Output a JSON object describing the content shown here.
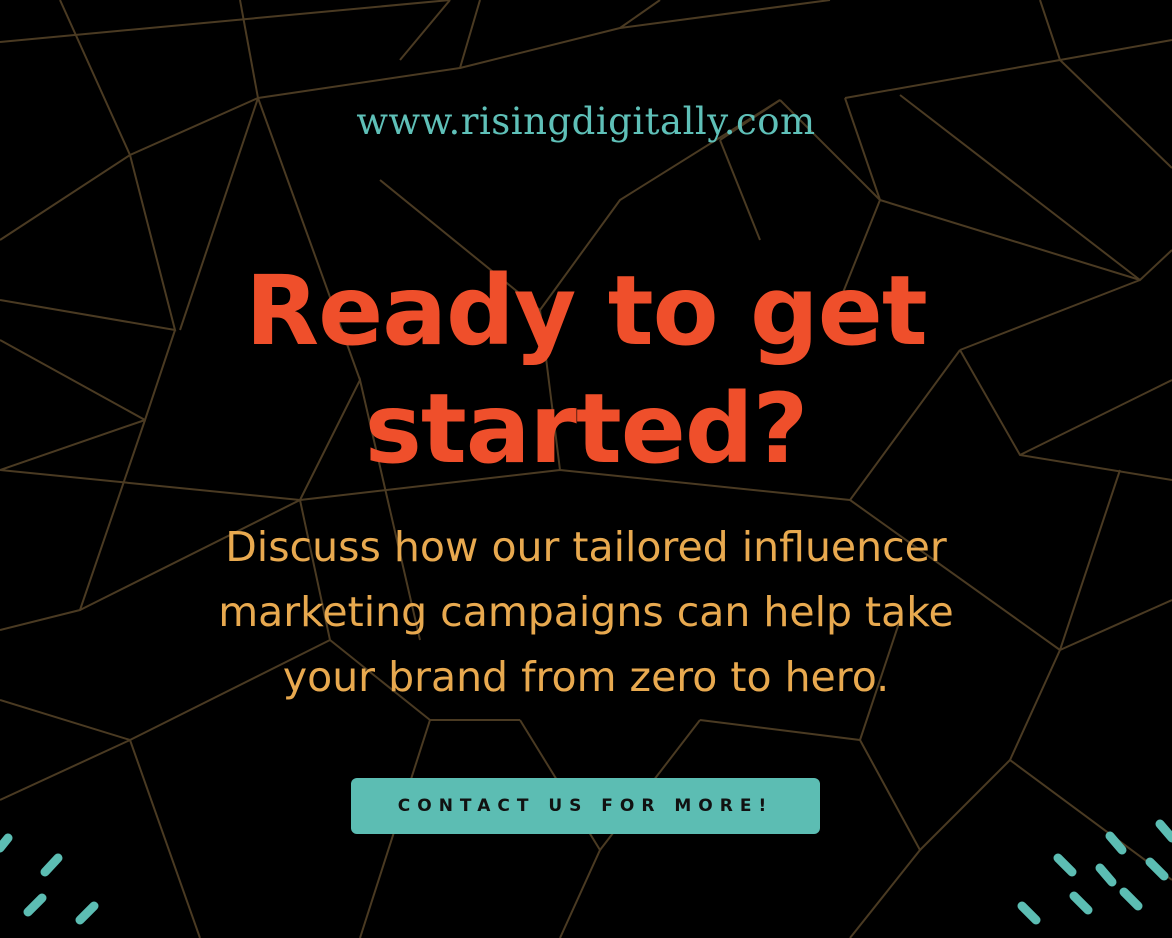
{
  "website": "www.risingdigitally.com",
  "headline": {
    "line1": "Ready to get",
    "line2": "started?"
  },
  "body": {
    "line1": "Discuss how our tailored influencer",
    "line2": "marketing campaigns can help take",
    "line3": "your brand from zero to hero."
  },
  "cta": {
    "label": "CONTACT US FOR MORE!"
  },
  "colors": {
    "background": "#000000",
    "lines": "#4a3a22",
    "url": "#5fc0b8",
    "headline": "#ef4f2b",
    "body": "#e8a94f",
    "button": "#5cbdb3",
    "dashes": "#5cbdb3"
  }
}
